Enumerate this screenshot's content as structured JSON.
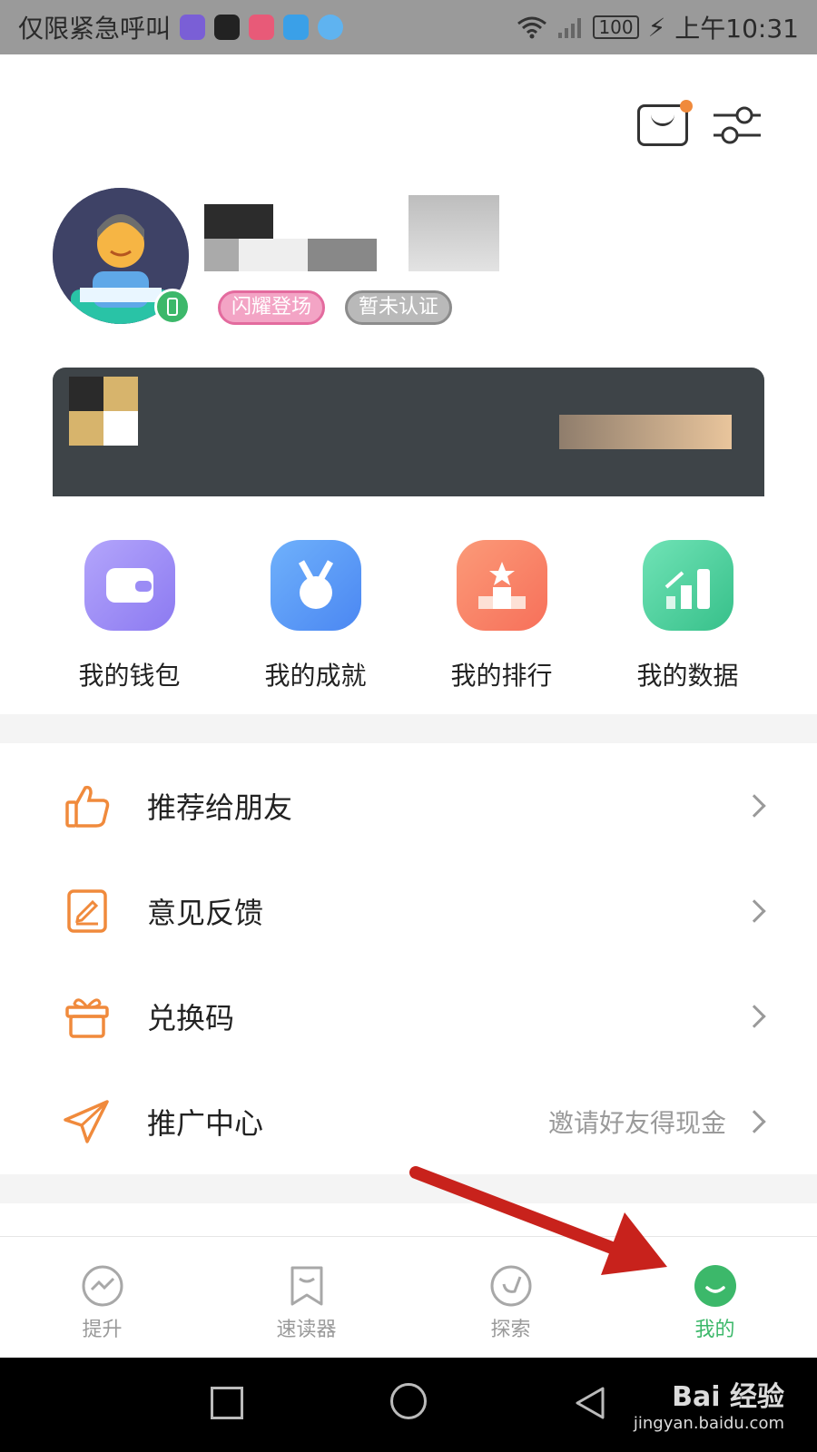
{
  "status_bar": {
    "carrier_text": "仅限紧急呼叫",
    "battery": "100",
    "time": "上午10:31"
  },
  "profile": {
    "tags": [
      "闪耀登场",
      "暂未认证"
    ]
  },
  "quick_actions": [
    {
      "label": "我的钱包",
      "icon": "wallet-icon",
      "color": "#9b8cf5"
    },
    {
      "label": "我的成就",
      "icon": "medal-icon",
      "color": "#5f9cf8"
    },
    {
      "label": "我的排行",
      "icon": "podium-icon",
      "color": "#f98a6c"
    },
    {
      "label": "我的数据",
      "icon": "chart-icon",
      "color": "#4fd3a0"
    }
  ],
  "menu": [
    {
      "label": "推荐给朋友",
      "icon": "thumbs-up-icon",
      "extra": ""
    },
    {
      "label": "意见反馈",
      "icon": "edit-icon",
      "extra": ""
    },
    {
      "label": "兑换码",
      "icon": "gift-icon",
      "extra": ""
    },
    {
      "label": "推广中心",
      "icon": "paper-plane-icon",
      "extra": "邀请好友得现金"
    }
  ],
  "bottom_nav": [
    {
      "label": "提升",
      "icon": "trend-icon",
      "active": false
    },
    {
      "label": "速读器",
      "icon": "bookmark-icon",
      "active": false
    },
    {
      "label": "探索",
      "icon": "explore-icon",
      "active": false
    },
    {
      "label": "我的",
      "icon": "smile-icon",
      "active": true
    }
  ],
  "watermark": {
    "brand": "Bai 经验",
    "url": "jingyan.baidu.com"
  },
  "colors": {
    "accent_green": "#3cb86a",
    "menu_icon_orange": "#f08a3c",
    "annotation_arrow": "#c8221c"
  }
}
